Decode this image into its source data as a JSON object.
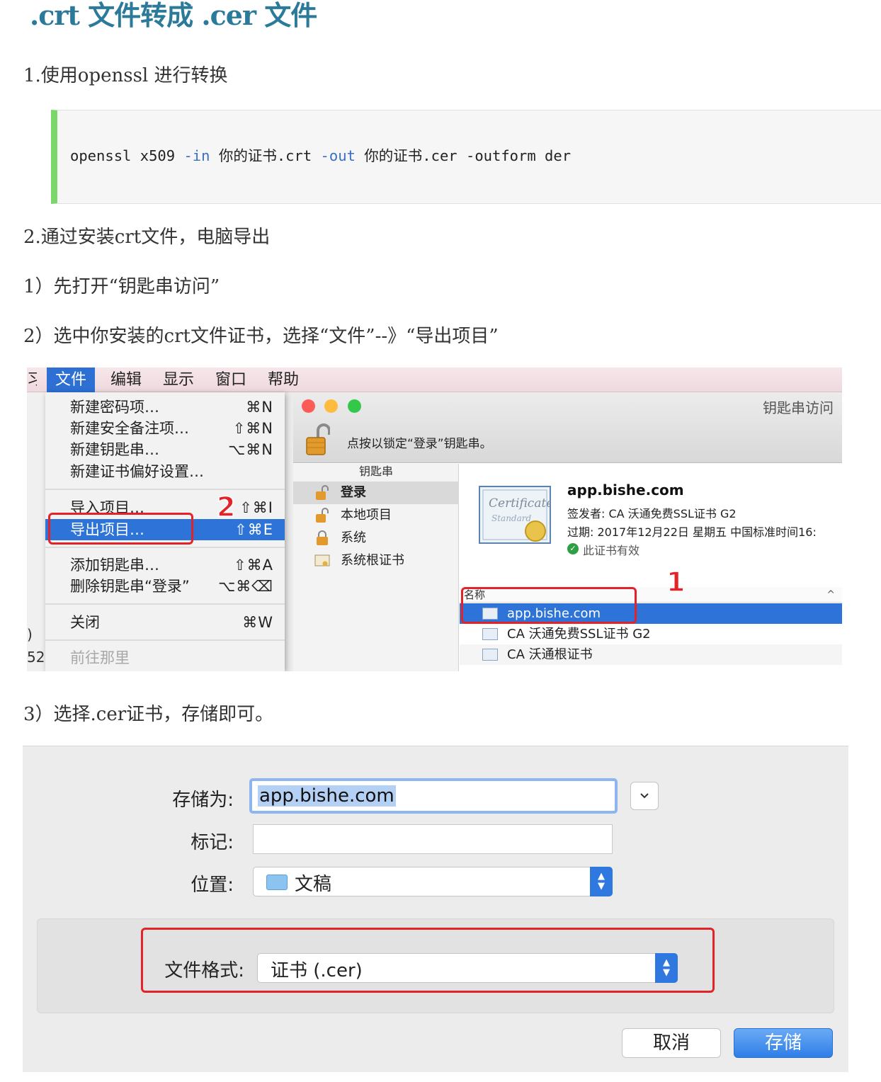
{
  "article": {
    "title": ".crt 文件转成 .cer 文件",
    "step1": "1.使用openssl 进行转换",
    "code": {
      "prefix": "openssl x509 ",
      "in_flag": "-in",
      "in_file": " 你的证书.crt ",
      "out_flag": "-out",
      "out_file": " 你的证书.cer -outform der"
    },
    "step2": "2.通过安装crt文件，电脑导出",
    "step2_1": "1）先打开“钥匙串访问”",
    "step2_2": "2）选中你安装的crt文件证书，选择“文件”--》“导出项目”",
    "step3": "3）选择.cer证书，存储即可。"
  },
  "menubar": {
    "partial": "习",
    "items": [
      "文件",
      "编辑",
      "显示",
      "窗口",
      "帮助"
    ]
  },
  "file_menu": [
    {
      "label": "新建密码项…",
      "shortcut": "⌘N"
    },
    {
      "label": "新建安全备注项…",
      "shortcut": "⇧⌘N"
    },
    {
      "label": "新建钥匙串…",
      "shortcut": "⌥⌘N"
    },
    {
      "label": "新建证书偏好设置…",
      "shortcut": ""
    },
    {
      "label": "导入项目…",
      "shortcut": "⇧⌘I"
    },
    {
      "label": "导出项目…",
      "shortcut": "⇧⌘E"
    },
    {
      "label": "添加钥匙串…",
      "shortcut": "⇧⌘A"
    },
    {
      "label": "删除钥匙串“登录”",
      "shortcut": "⌥⌘⌫"
    },
    {
      "label": "关闭",
      "shortcut": "⌘W"
    },
    {
      "label": "前往那里",
      "shortcut": ""
    }
  ],
  "left_fragment": [
    ")",
    "52)"
  ],
  "keychain": {
    "window_title": "钥匙串访问",
    "lock_text": "点按以锁定“登录”钥匙串。",
    "sidebar_header": "钥匙串",
    "sidebar_items": [
      "登录",
      "本地项目",
      "系统",
      "系统根证书"
    ],
    "cert": {
      "name": "app.bishe.com",
      "issuer": "签发者: CA 沃通免费SSL证书 G2",
      "expires": "过期: 2017年12月22日 星期五 中国标准时间16:",
      "valid": "此证书有效",
      "art_title": "Certificate",
      "art_sub": "Standard"
    },
    "column_name": "名称",
    "rows": [
      "app.bishe.com",
      "CA 沃通免费SSL证书 G2",
      "CA 沃通根证书"
    ]
  },
  "callouts": {
    "one": "1",
    "two": "2"
  },
  "save_dialog": {
    "save_as_label": "存储为:",
    "save_as_value": "app.bishe.com",
    "tags_label": "标记:",
    "where_label": "位置:",
    "where_value": "文稿",
    "format_label": "文件格式:",
    "format_value": "证书 (.cer)",
    "cancel": "取消",
    "save": "存储"
  },
  "colors": {
    "title": "#2b7a9a",
    "code_border": "#7ad86a",
    "selection": "#2e74d8",
    "annotation": "#e2232a"
  },
  "icons": {
    "lock": "open-padlock-icon",
    "valid": "checkmark-circle-icon",
    "folder": "folder-icon",
    "chevron": "chevron-down-icon",
    "certificate": "certificate-icon"
  }
}
